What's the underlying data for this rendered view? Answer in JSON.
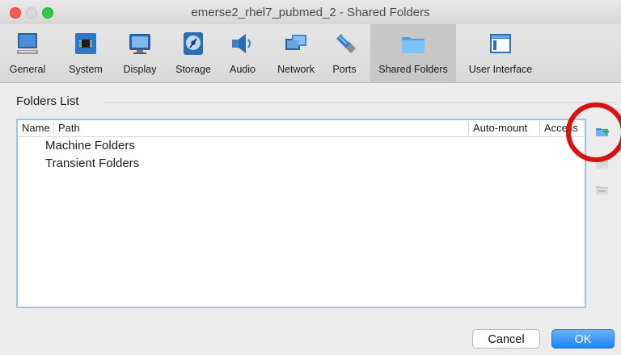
{
  "window": {
    "title": "emerse2_rhel7_pubmed_2 - Shared Folders"
  },
  "toolbar": {
    "items": [
      {
        "label": "General",
        "icon": "general-icon"
      },
      {
        "label": "System",
        "icon": "system-icon"
      },
      {
        "label": "Display",
        "icon": "display-icon"
      },
      {
        "label": "Storage",
        "icon": "storage-icon"
      },
      {
        "label": "Audio",
        "icon": "audio-icon"
      },
      {
        "label": "Network",
        "icon": "network-icon"
      },
      {
        "label": "Ports",
        "icon": "ports-icon"
      },
      {
        "label": "Shared Folders",
        "icon": "shared-folders-icon",
        "active": true
      },
      {
        "label": "User Interface",
        "icon": "user-interface-icon"
      }
    ]
  },
  "section": {
    "title": "Folders List"
  },
  "list": {
    "columns": [
      "Name",
      "Path",
      "Auto-mount",
      "Access"
    ],
    "rows": [
      "Machine Folders",
      "Transient Folders"
    ]
  },
  "side_buttons": [
    "add-shared-folder-icon",
    "edit-shared-folder-icon",
    "remove-shared-folder-icon"
  ],
  "footer": {
    "cancel_label": "Cancel",
    "ok_label": "OK"
  },
  "colors": {
    "accent": "#1a82fb",
    "list_border": "#9cc2ee",
    "annotation_ring": "#d9120f"
  }
}
